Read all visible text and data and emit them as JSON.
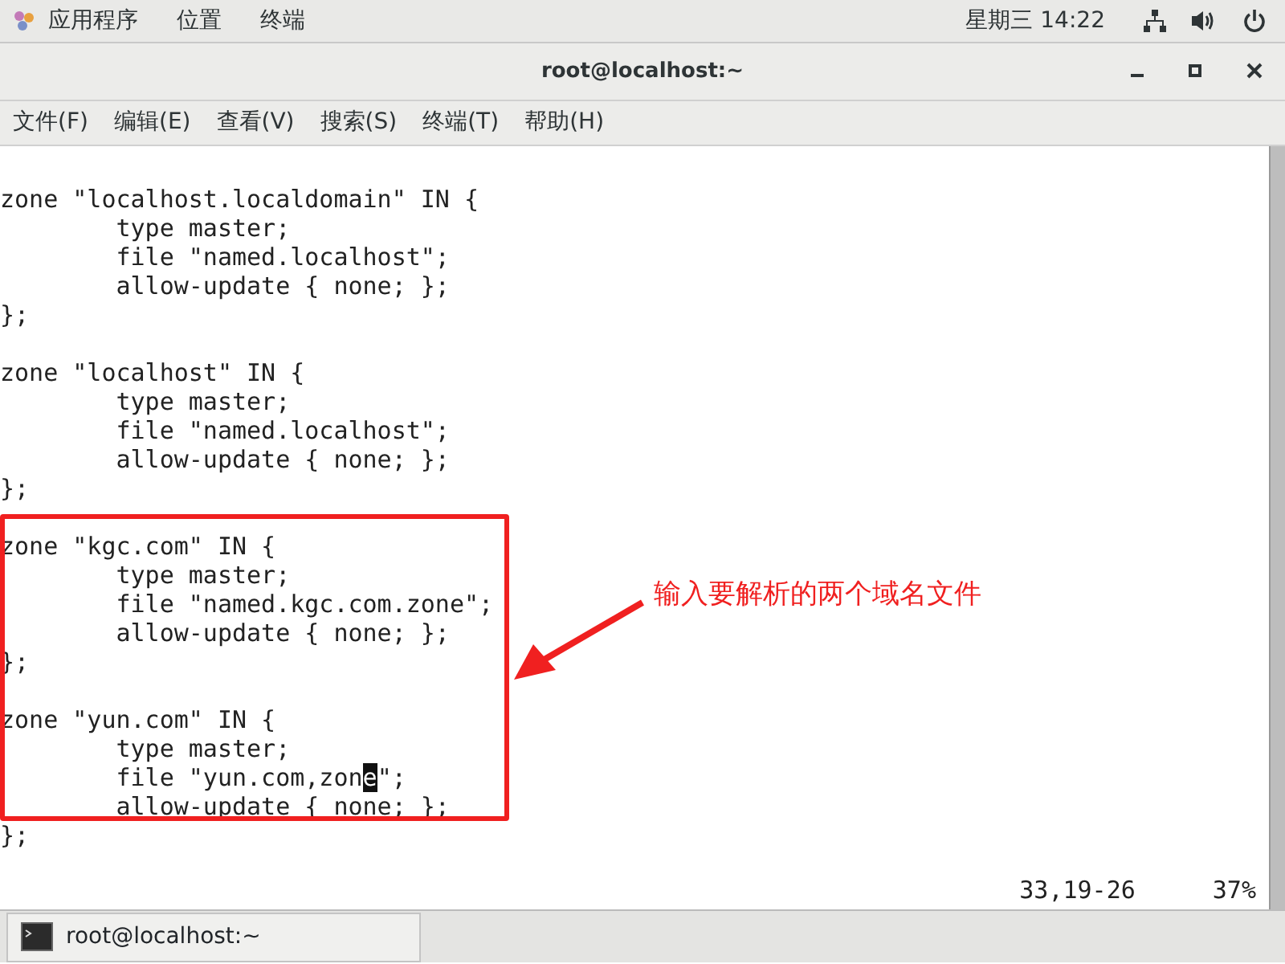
{
  "top_bar": {
    "menus": [
      "应用程序",
      "位置",
      "终端"
    ],
    "clock": "星期三 14:22"
  },
  "window": {
    "title": "root@localhost:~"
  },
  "menu_bar": [
    "文件(F)",
    "编辑(E)",
    "查看(V)",
    "搜索(S)",
    "终端(T)",
    "帮助(H)"
  ],
  "terminal": {
    "lines": [
      {
        "kind": "text",
        "text": "zone \"localhost.localdomain\" IN {"
      },
      {
        "kind": "text",
        "text": "        type master;"
      },
      {
        "kind": "text",
        "text": "        file \"named.localhost\";"
      },
      {
        "kind": "text",
        "text": "        allow-update { none; };"
      },
      {
        "kind": "text",
        "text": "};"
      },
      {
        "kind": "blank"
      },
      {
        "kind": "text",
        "text": "zone \"localhost\" IN {"
      },
      {
        "kind": "text",
        "text": "        type master;"
      },
      {
        "kind": "text",
        "text": "        file \"named.localhost\";"
      },
      {
        "kind": "text",
        "text": "        allow-update { none; };"
      },
      {
        "kind": "text",
        "text": "};"
      },
      {
        "kind": "blank"
      },
      {
        "kind": "text",
        "text": "zone \"kgc.com\" IN {"
      },
      {
        "kind": "text",
        "text": "        type master;"
      },
      {
        "kind": "text",
        "text": "        file \"named.kgc.com.zone\";"
      },
      {
        "kind": "text",
        "text": "        allow-update { none; };"
      },
      {
        "kind": "text",
        "text": "};"
      },
      {
        "kind": "blank"
      },
      {
        "kind": "text",
        "text": "zone \"yun.com\" IN {"
      },
      {
        "kind": "text",
        "text": "        type master;"
      },
      {
        "kind": "text",
        "text": "        file \"yun.com,zon",
        "cursor": "e",
        "rest": "\";"
      },
      {
        "kind": "text",
        "text": "        allow-update { none; };"
      },
      {
        "kind": "text",
        "text": "};"
      }
    ],
    "status": {
      "position": "33,19-26",
      "percent": "37%"
    }
  },
  "annotation": {
    "text": "输入要解析的两个域名文件"
  },
  "taskbar": {
    "items": [
      {
        "label": "root@localhost:~"
      }
    ]
  }
}
